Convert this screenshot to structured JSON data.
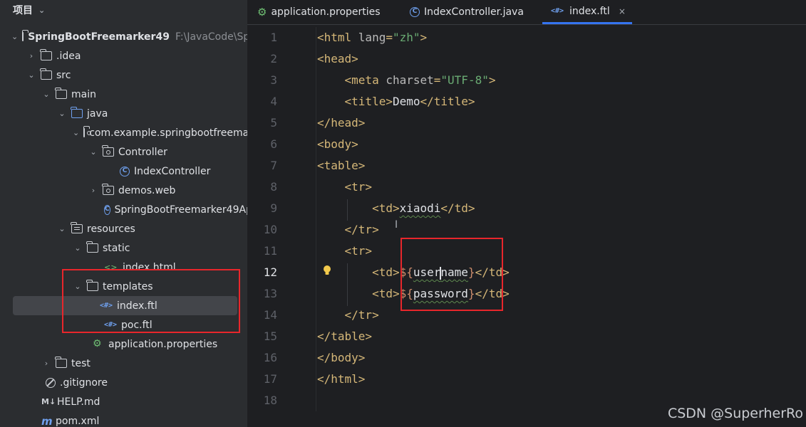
{
  "sidebar": {
    "title": "项目",
    "tree": [
      {
        "label": "SpringBootFreemarker49",
        "path": "F:\\JavaCode\\Spri",
        "icon": "folder-icon"
      },
      {
        "label": ".idea",
        "icon": "folder-icon"
      },
      {
        "label": "src",
        "icon": "folder-icon"
      },
      {
        "label": "main",
        "icon": "folder-icon"
      },
      {
        "label": "java",
        "icon": "folder-blue-icon"
      },
      {
        "label": "com.example.springbootfreema",
        "icon": "package-icon"
      },
      {
        "label": "Controller",
        "icon": "package-icon"
      },
      {
        "label": "IndexController",
        "icon": "class-icon"
      },
      {
        "label": "demos.web",
        "icon": "package-icon"
      },
      {
        "label": "SpringBootFreemarker49Ap",
        "icon": "spring-class-icon"
      },
      {
        "label": "resources",
        "icon": "resources-folder-icon"
      },
      {
        "label": "static",
        "icon": "folder-icon"
      },
      {
        "label": "index.html",
        "icon": "html-file-icon"
      },
      {
        "label": "templates",
        "icon": "folder-icon"
      },
      {
        "label": "index.ftl",
        "icon": "ftl-file-icon"
      },
      {
        "label": "poc.ftl",
        "icon": "ftl-file-icon"
      },
      {
        "label": "application.properties",
        "icon": "properties-file-icon"
      },
      {
        "label": "test",
        "icon": "folder-icon"
      },
      {
        "label": ".gitignore",
        "icon": "gitignore-icon"
      },
      {
        "label": "HELP.md",
        "icon": "markdown-icon"
      },
      {
        "label": "pom.xml",
        "icon": "maven-icon"
      }
    ]
  },
  "tabs": [
    {
      "label": "application.properties",
      "icon": "properties-file-icon"
    },
    {
      "label": "IndexController.java",
      "icon": "class-icon"
    },
    {
      "label": "index.ftl",
      "icon": "ftl-file-icon",
      "close": "×"
    }
  ],
  "editor": {
    "line_numbers": [
      "1",
      "2",
      "3",
      "4",
      "5",
      "6",
      "7",
      "8",
      "9",
      "10",
      "11",
      "12",
      "13",
      "14",
      "15",
      "16",
      "17",
      "18"
    ],
    "current_line": "12",
    "lines": [
      "<html lang=\"zh\">",
      "<head>",
      "    <meta charset=\"UTF-8\">",
      "    <title>Demo</title>",
      "</head>",
      "<body>",
      "<table>",
      "    <tr>",
      "        <td>xiaodi</td>",
      "    </tr>",
      "    <tr>",
      "        <td>${username}</td>",
      "        <td>${password}</td>",
      "    </tr>",
      "</table>",
      "</body>",
      "</html>",
      ""
    ]
  },
  "ftl_icon_text": "<#>",
  "class_icon_text": "C",
  "md_icon_text": "M↓",
  "maven_icon_text": "m",
  "watermark": "CSDN @SuperherRo",
  "colors": {
    "highlight_box": "#e8262b",
    "accent": "#3574f0"
  }
}
